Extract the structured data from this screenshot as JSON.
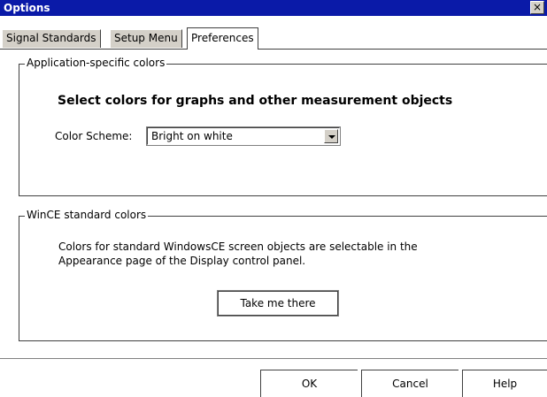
{
  "window": {
    "title": "Options",
    "close_label": "×"
  },
  "tabs": [
    {
      "label": "Signal Standards",
      "active": false
    },
    {
      "label": "Setup Menu",
      "active": false
    },
    {
      "label": "Preferences",
      "active": true
    }
  ],
  "app_colors": {
    "legend": "Application-specific colors",
    "heading": "Select colors for graphs and other measurement objects",
    "scheme_label": "Color Scheme:",
    "scheme_value": "Bright on white"
  },
  "wince_colors": {
    "legend": "WinCE standard colors",
    "description_line1": "Colors for standard WindowsCE screen objects are selectable in the",
    "description_line2": "Appearance page of the Display control panel.",
    "button_label": "Take me there"
  },
  "footer": {
    "ok_label": "OK",
    "cancel_label": "Cancel",
    "help_label": "Help"
  },
  "colors": {
    "titlebar": "#0a1aa8",
    "background": "#ffffff",
    "chrome": "#d4d0c8"
  }
}
